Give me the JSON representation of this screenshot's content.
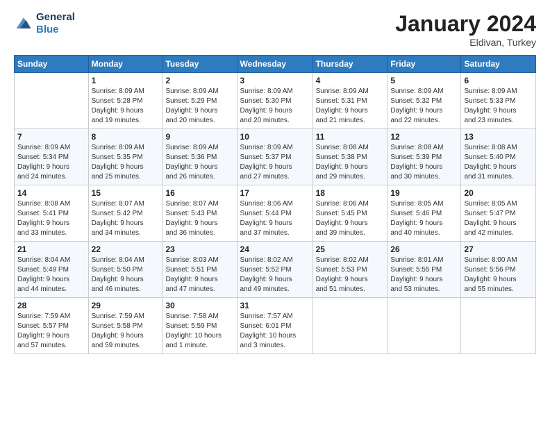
{
  "header": {
    "logo_line1": "General",
    "logo_line2": "Blue",
    "month_title": "January 2024",
    "location": "Eldivan, Turkey"
  },
  "weekdays": [
    "Sunday",
    "Monday",
    "Tuesday",
    "Wednesday",
    "Thursday",
    "Friday",
    "Saturday"
  ],
  "weeks": [
    [
      {
        "day": "",
        "info": ""
      },
      {
        "day": "1",
        "info": "Sunrise: 8:09 AM\nSunset: 5:28 PM\nDaylight: 9 hours\nand 19 minutes."
      },
      {
        "day": "2",
        "info": "Sunrise: 8:09 AM\nSunset: 5:29 PM\nDaylight: 9 hours\nand 20 minutes."
      },
      {
        "day": "3",
        "info": "Sunrise: 8:09 AM\nSunset: 5:30 PM\nDaylight: 9 hours\nand 20 minutes."
      },
      {
        "day": "4",
        "info": "Sunrise: 8:09 AM\nSunset: 5:31 PM\nDaylight: 9 hours\nand 21 minutes."
      },
      {
        "day": "5",
        "info": "Sunrise: 8:09 AM\nSunset: 5:32 PM\nDaylight: 9 hours\nand 22 minutes."
      },
      {
        "day": "6",
        "info": "Sunrise: 8:09 AM\nSunset: 5:33 PM\nDaylight: 9 hours\nand 23 minutes."
      }
    ],
    [
      {
        "day": "7",
        "info": "Sunrise: 8:09 AM\nSunset: 5:34 PM\nDaylight: 9 hours\nand 24 minutes."
      },
      {
        "day": "8",
        "info": "Sunrise: 8:09 AM\nSunset: 5:35 PM\nDaylight: 9 hours\nand 25 minutes."
      },
      {
        "day": "9",
        "info": "Sunrise: 8:09 AM\nSunset: 5:36 PM\nDaylight: 9 hours\nand 26 minutes."
      },
      {
        "day": "10",
        "info": "Sunrise: 8:09 AM\nSunset: 5:37 PM\nDaylight: 9 hours\nand 27 minutes."
      },
      {
        "day": "11",
        "info": "Sunrise: 8:08 AM\nSunset: 5:38 PM\nDaylight: 9 hours\nand 29 minutes."
      },
      {
        "day": "12",
        "info": "Sunrise: 8:08 AM\nSunset: 5:39 PM\nDaylight: 9 hours\nand 30 minutes."
      },
      {
        "day": "13",
        "info": "Sunrise: 8:08 AM\nSunset: 5:40 PM\nDaylight: 9 hours\nand 31 minutes."
      }
    ],
    [
      {
        "day": "14",
        "info": "Sunrise: 8:08 AM\nSunset: 5:41 PM\nDaylight: 9 hours\nand 33 minutes."
      },
      {
        "day": "15",
        "info": "Sunrise: 8:07 AM\nSunset: 5:42 PM\nDaylight: 9 hours\nand 34 minutes."
      },
      {
        "day": "16",
        "info": "Sunrise: 8:07 AM\nSunset: 5:43 PM\nDaylight: 9 hours\nand 36 minutes."
      },
      {
        "day": "17",
        "info": "Sunrise: 8:06 AM\nSunset: 5:44 PM\nDaylight: 9 hours\nand 37 minutes."
      },
      {
        "day": "18",
        "info": "Sunrise: 8:06 AM\nSunset: 5:45 PM\nDaylight: 9 hours\nand 39 minutes."
      },
      {
        "day": "19",
        "info": "Sunrise: 8:05 AM\nSunset: 5:46 PM\nDaylight: 9 hours\nand 40 minutes."
      },
      {
        "day": "20",
        "info": "Sunrise: 8:05 AM\nSunset: 5:47 PM\nDaylight: 9 hours\nand 42 minutes."
      }
    ],
    [
      {
        "day": "21",
        "info": "Sunrise: 8:04 AM\nSunset: 5:49 PM\nDaylight: 9 hours\nand 44 minutes."
      },
      {
        "day": "22",
        "info": "Sunrise: 8:04 AM\nSunset: 5:50 PM\nDaylight: 9 hours\nand 46 minutes."
      },
      {
        "day": "23",
        "info": "Sunrise: 8:03 AM\nSunset: 5:51 PM\nDaylight: 9 hours\nand 47 minutes."
      },
      {
        "day": "24",
        "info": "Sunrise: 8:02 AM\nSunset: 5:52 PM\nDaylight: 9 hours\nand 49 minutes."
      },
      {
        "day": "25",
        "info": "Sunrise: 8:02 AM\nSunset: 5:53 PM\nDaylight: 9 hours\nand 51 minutes."
      },
      {
        "day": "26",
        "info": "Sunrise: 8:01 AM\nSunset: 5:55 PM\nDaylight: 9 hours\nand 53 minutes."
      },
      {
        "day": "27",
        "info": "Sunrise: 8:00 AM\nSunset: 5:56 PM\nDaylight: 9 hours\nand 55 minutes."
      }
    ],
    [
      {
        "day": "28",
        "info": "Sunrise: 7:59 AM\nSunset: 5:57 PM\nDaylight: 9 hours\nand 57 minutes."
      },
      {
        "day": "29",
        "info": "Sunrise: 7:59 AM\nSunset: 5:58 PM\nDaylight: 9 hours\nand 59 minutes."
      },
      {
        "day": "30",
        "info": "Sunrise: 7:58 AM\nSunset: 5:59 PM\nDaylight: 10 hours\nand 1 minute."
      },
      {
        "day": "31",
        "info": "Sunrise: 7:57 AM\nSunset: 6:01 PM\nDaylight: 10 hours\nand 3 minutes."
      },
      {
        "day": "",
        "info": ""
      },
      {
        "day": "",
        "info": ""
      },
      {
        "day": "",
        "info": ""
      }
    ]
  ]
}
